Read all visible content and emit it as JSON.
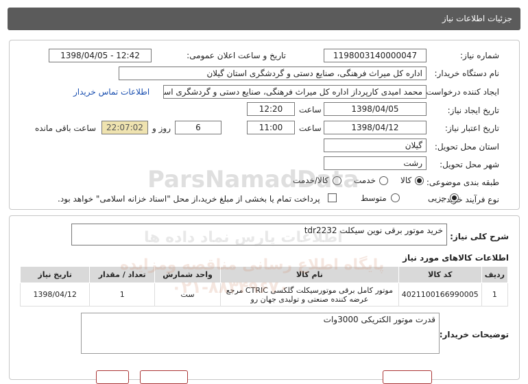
{
  "header": {
    "title": "جزئیات اطلاعات نیاز"
  },
  "details": {
    "need_number_label": "شماره نیاز:",
    "need_number": "1198003140000047",
    "announce_label": "تاریخ و ساعت اعلان عمومی:",
    "announce_value": "1398/04/05 - 12:42",
    "buyer_org_label": "نام دستگاه خریدار:",
    "buyer_org": "اداره کل میراث فرهنگی، صنایع دستی و گردشگری استان گیلان",
    "requester_label": "ایجاد کننده درخواست:",
    "requester": "محمد امیدی کارپرداز اداره کل میراث فرهنگی، صنایع دستی و گردشگری استان گیلان",
    "contact_link": "اطلاعات تماس خریدار",
    "created_label": "تاریخ ایجاد نیاز:",
    "created_date": "1398/04/05",
    "time_label": "ساعت",
    "created_time": "12:20",
    "validity_label": "تاریخ اعتبار نیاز:",
    "validity_date": "1398/04/12",
    "validity_time": "11:00",
    "days_value": "6",
    "days_label": "روز و",
    "remaining_time": "22:07:02",
    "remaining_label": "ساعت باقی مانده",
    "province_label": "استان محل تحویل:",
    "province": "گیلان",
    "city_label": "شهر محل تحویل:",
    "city": "رشت",
    "category_label": "طبقه بندی موضوعی:",
    "category_options": [
      "کالا",
      "خدمت",
      "کالا/خدمت"
    ],
    "purchase_label": "نوع فرآیند خرید :",
    "purchase_options": [
      "جزیی",
      "متوسط"
    ],
    "payment_note": "پرداخت تمام یا بخشی از مبلغ خرید،از محل \"اسناد خزانه اسلامی\" خواهد بود."
  },
  "summary": {
    "label": "شرح کلی نیاز:",
    "value": "خرید موتور برقی نوین سیکلت tdr2232"
  },
  "items_section": {
    "title": "اطلاعات کالاهای مورد نیاز",
    "headers": [
      "ردیف",
      "کد کالا",
      "نام کالا",
      "واحد شمارش",
      "تعداد / مقدار",
      "تاریخ نیاز"
    ],
    "rows": [
      {
        "row": "1",
        "code": "4021100166990005",
        "name": "موتور کامل برقی موتورسیکلت گلکسی CTRIC مرجع عرضه کننده صنعتی و تولیدی جهان رو",
        "unit": "ست",
        "qty": "1",
        "date": "1398/04/12"
      }
    ]
  },
  "buyer_notes": {
    "label": "توضیحات خریدار:",
    "value": "قدرت موتور الکتریکی 3000وات"
  },
  "watermark": {
    "line1": "ParsNamadData",
    "line2": "اطلاعات پارس نماد داده ها",
    "line3": "پایگاه اطلاع رسانی مناقصه ومزایده",
    "line4": "۰۲۱-۸۸۳۴۹۶۷۰"
  },
  "colors": {
    "header_bg": "#5b5b5b",
    "timer_bg": "#efe3b0",
    "link": "#1a4fb0"
  }
}
